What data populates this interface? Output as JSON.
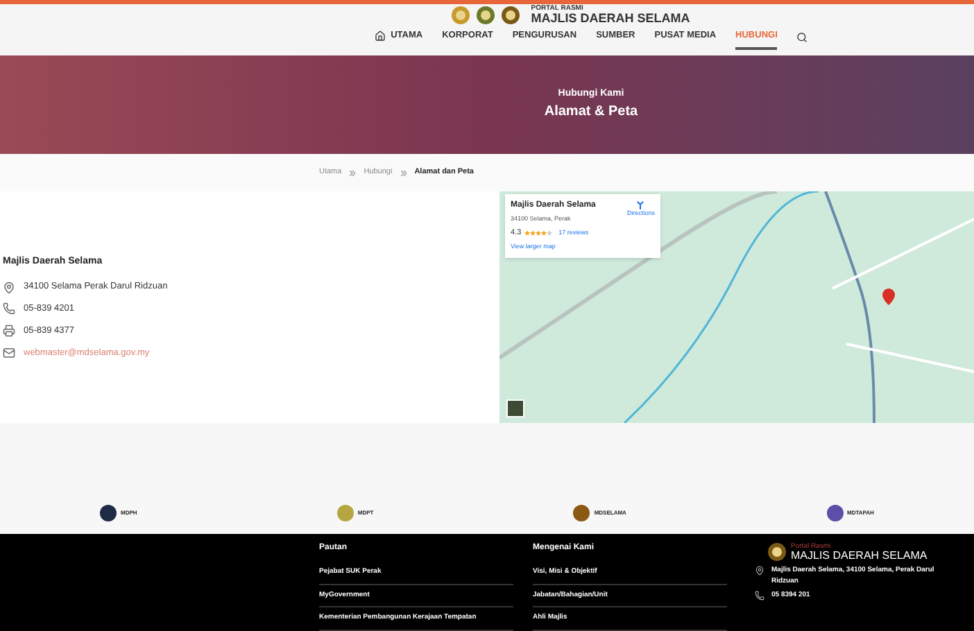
{
  "header": {
    "logo_small": "PORTAL RASMI",
    "logo_title": "MAJLIS DAERAH SELAMA",
    "nav": [
      {
        "label": "UTAMA",
        "selected": false,
        "kind": "home"
      },
      {
        "label": "KORPORAT",
        "selected": false,
        "kind": "text"
      },
      {
        "label": "PENGURUSAN",
        "selected": false,
        "kind": "text"
      },
      {
        "label": "SUMBER",
        "selected": false,
        "kind": "text"
      },
      {
        "label": "PUSAT MEDIA",
        "selected": false,
        "kind": "text"
      },
      {
        "label": "HUBUNGI",
        "selected": true,
        "kind": "text"
      }
    ]
  },
  "banner": {
    "subtitle": "Hubungi Kami",
    "title": "Alamat & Peta"
  },
  "breadcrumb": [
    "Utama",
    "Hubungi",
    "Alamat dan Peta"
  ],
  "contact": {
    "name": "Majlis Daerah Selama",
    "items": [
      {
        "kind": "address",
        "text": "34100 Selama Perak Darul Ridzuan"
      },
      {
        "kind": "phone",
        "text": "05-839 4201"
      },
      {
        "kind": "fax",
        "text": "05-839 4377"
      },
      {
        "kind": "email",
        "text": "webmaster@mdselama.gov.my"
      }
    ]
  },
  "map_card": {
    "name": "Majlis Daerah Selama",
    "address": "34100 Selama, Perak",
    "rating": "4.3",
    "stars": 4,
    "reviews": "17 reviews",
    "directions": "Directions",
    "larger_map": "View larger map"
  },
  "partners": [
    {
      "label": "MDPH",
      "color": "#1f2a44"
    },
    {
      "label": "MDPT",
      "color": "#b5a642"
    },
    {
      "label": "MDSELAMA",
      "color": "#8a5a12"
    },
    {
      "label": "MDTAPAH",
      "color": "#5b4fa8"
    }
  ],
  "footer": {
    "links_title": "Pautan",
    "links": [
      "Pejabat SUK Perak",
      "MyGovernment",
      "Kementerian Pembangunan Kerajaan Tempatan"
    ],
    "about_title": "Mengenai Kami",
    "about": [
      "Visi, Misi & Objektif",
      "Jabatan/Bahagian/Unit",
      "Ahli Majlis"
    ],
    "logo_small": "Portal Rasmi",
    "logo_title": "MAJLIS DAERAH SELAMA",
    "address": "Majlis Daerah Selama, 34100 Selama, Perak Darul Ridzuan",
    "phone": "05 8394 201"
  }
}
